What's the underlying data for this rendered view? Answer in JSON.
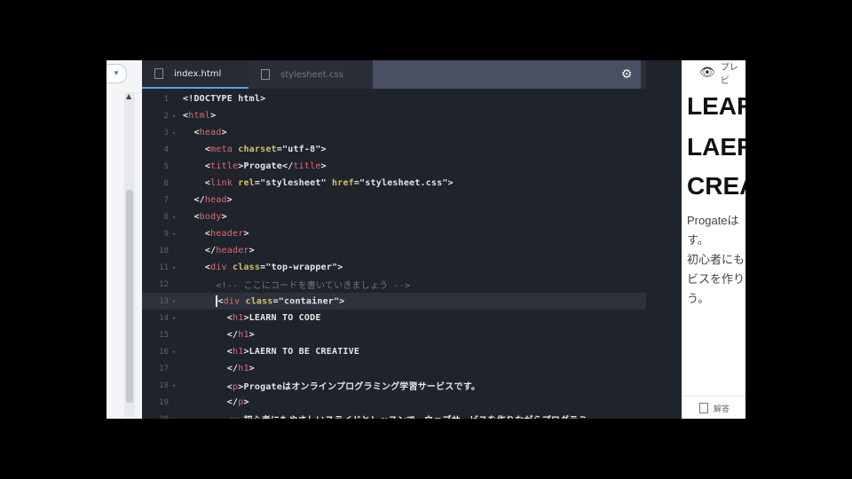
{
  "sidebar": {
    "pill_icon": "chevron-down-icon",
    "pill_text": "▾"
  },
  "tabs": [
    {
      "label": "index.html"
    },
    {
      "label": "stylesheet.css"
    }
  ],
  "code_lines": [
    {
      "n": "1",
      "fold": "",
      "html": "&lt;!DOCTYPE html&gt;"
    },
    {
      "n": "2",
      "fold": "▾",
      "html": "&lt;<span class='tag'>html</span>&gt;"
    },
    {
      "n": "3",
      "fold": "▾",
      "html": "  &lt;<span class='tag'>head</span>&gt;"
    },
    {
      "n": "4",
      "fold": "",
      "html": "    &lt;<span class='tag'>meta</span> <span class='attr'>charset</span>=\"utf-8\"&gt;"
    },
    {
      "n": "5",
      "fold": "",
      "html": "    &lt;<span class='tag'>title</span>&gt;Progate&lt;/<span class='tag'>title</span>&gt;"
    },
    {
      "n": "6",
      "fold": "",
      "html": "    &lt;<span class='tag'>link</span> <span class='attr'>rel</span>=\"stylesheet\" <span class='attr'>href</span>=\"stylesheet.css\"&gt;"
    },
    {
      "n": "7",
      "fold": "",
      "html": "  &lt;/<span class='tag'>head</span>&gt;"
    },
    {
      "n": "8",
      "fold": "▾",
      "html": "  &lt;<span class='tag'>body</span>&gt;"
    },
    {
      "n": "9",
      "fold": "▾",
      "html": "    &lt;<span class='tag'>header</span>&gt;"
    },
    {
      "n": "10",
      "fold": "",
      "html": "    &lt;/<span class='tag'>header</span>&gt;"
    },
    {
      "n": "11",
      "fold": "▾",
      "html": "    &lt;<span class='tag'>div</span> <span class='attr'>class</span>=\"top-wrapper\"&gt;"
    },
    {
      "n": "12",
      "fold": "",
      "html": "      <span class='cm'>&lt;!-- ここにコードを書いていきましょう --&gt;</span>"
    },
    {
      "n": "13",
      "fold": "▾",
      "html": "      <span class='cursor'></span>&lt;<span class='tag'>div</span> <span class='attr'>class</span>=\"container\"&gt;",
      "active": true
    },
    {
      "n": "14",
      "fold": "▾",
      "html": "        &lt;<span class='tag'>h1</span>&gt;LEARN TO CODE"
    },
    {
      "n": "15",
      "fold": "",
      "html": "        &lt;/<span class='tag'>h1</span>&gt;"
    },
    {
      "n": "16",
      "fold": "▾",
      "html": "        &lt;<span class='tag'>h1</span>&gt;LAERN TO BE CREATIVE"
    },
    {
      "n": "17",
      "fold": "",
      "html": "        &lt;/<span class='tag'>h1</span>&gt;"
    },
    {
      "n": "18",
      "fold": "▾",
      "html": "        &lt;<span class='tag'>p</span>&gt;Progateはオンラインプログラミング学習サービスです。"
    },
    {
      "n": "19",
      "fold": "",
      "html": "        &lt;/<span class='tag'>p</span>&gt;"
    },
    {
      "n": "20",
      "fold": "▾",
      "html": "        &lt;<span class='tag'>p</span>&gt;初心者にもやさしいスライドとレッスンで、ウェブサービスを作りながらプログラミ"
    }
  ],
  "preview": {
    "label": "プレビ",
    "h1a": "LEAR",
    "h1b": "LAER",
    "h1c": "CREA",
    "p1": "Progateは",
    "p2": "す。",
    "p3": "初心者にも",
    "p4": "ビスを作り",
    "p5": "う。",
    "footer": "解答"
  }
}
